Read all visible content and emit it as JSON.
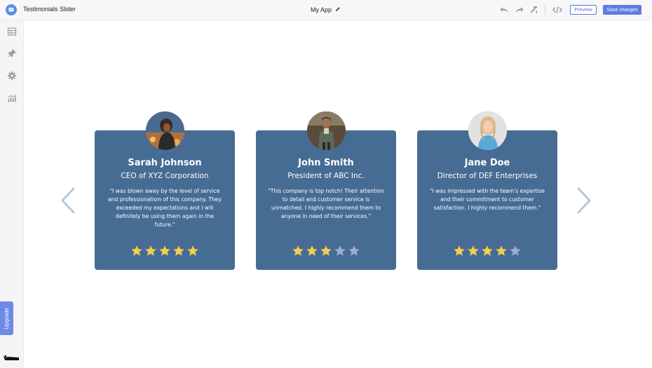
{
  "topbar": {
    "app_name": "Testimonials Slider",
    "title": "My App",
    "preview_label": "Preview",
    "save_label": "Save changes"
  },
  "sidebar": {
    "upgrade_label": "Upgrade"
  },
  "colors": {
    "card_bg": "#466c94",
    "star_filled": "#f2cf4a",
    "star_empty": "#9aaed0",
    "arrow": "#b7c7de",
    "accent": "#5f7ce0"
  },
  "testimonials": [
    {
      "name": "Sarah Johnson",
      "role": "CEO of XYZ Corporation",
      "quote": "\"I was blown away by the level of service and professionalism of this company. They exceeded my expectations and I will definitely be using them again in the future.\"",
      "rating": 5,
      "max_rating": 5
    },
    {
      "name": "John Smith",
      "role": "President of ABC Inc.",
      "quote": "\"This company is top notch! Their attention to detail and customer service is unmatched. I highly recommend them to anyone in need of their services.\"",
      "rating": 3,
      "max_rating": 5
    },
    {
      "name": "Jane Doe",
      "role": "Director of DEF Enterprises",
      "quote": "\"I was impressed with the team's expertise and their commitment to customer satisfaction. I highly recommend them.\"",
      "rating": 4,
      "max_rating": 5
    }
  ]
}
